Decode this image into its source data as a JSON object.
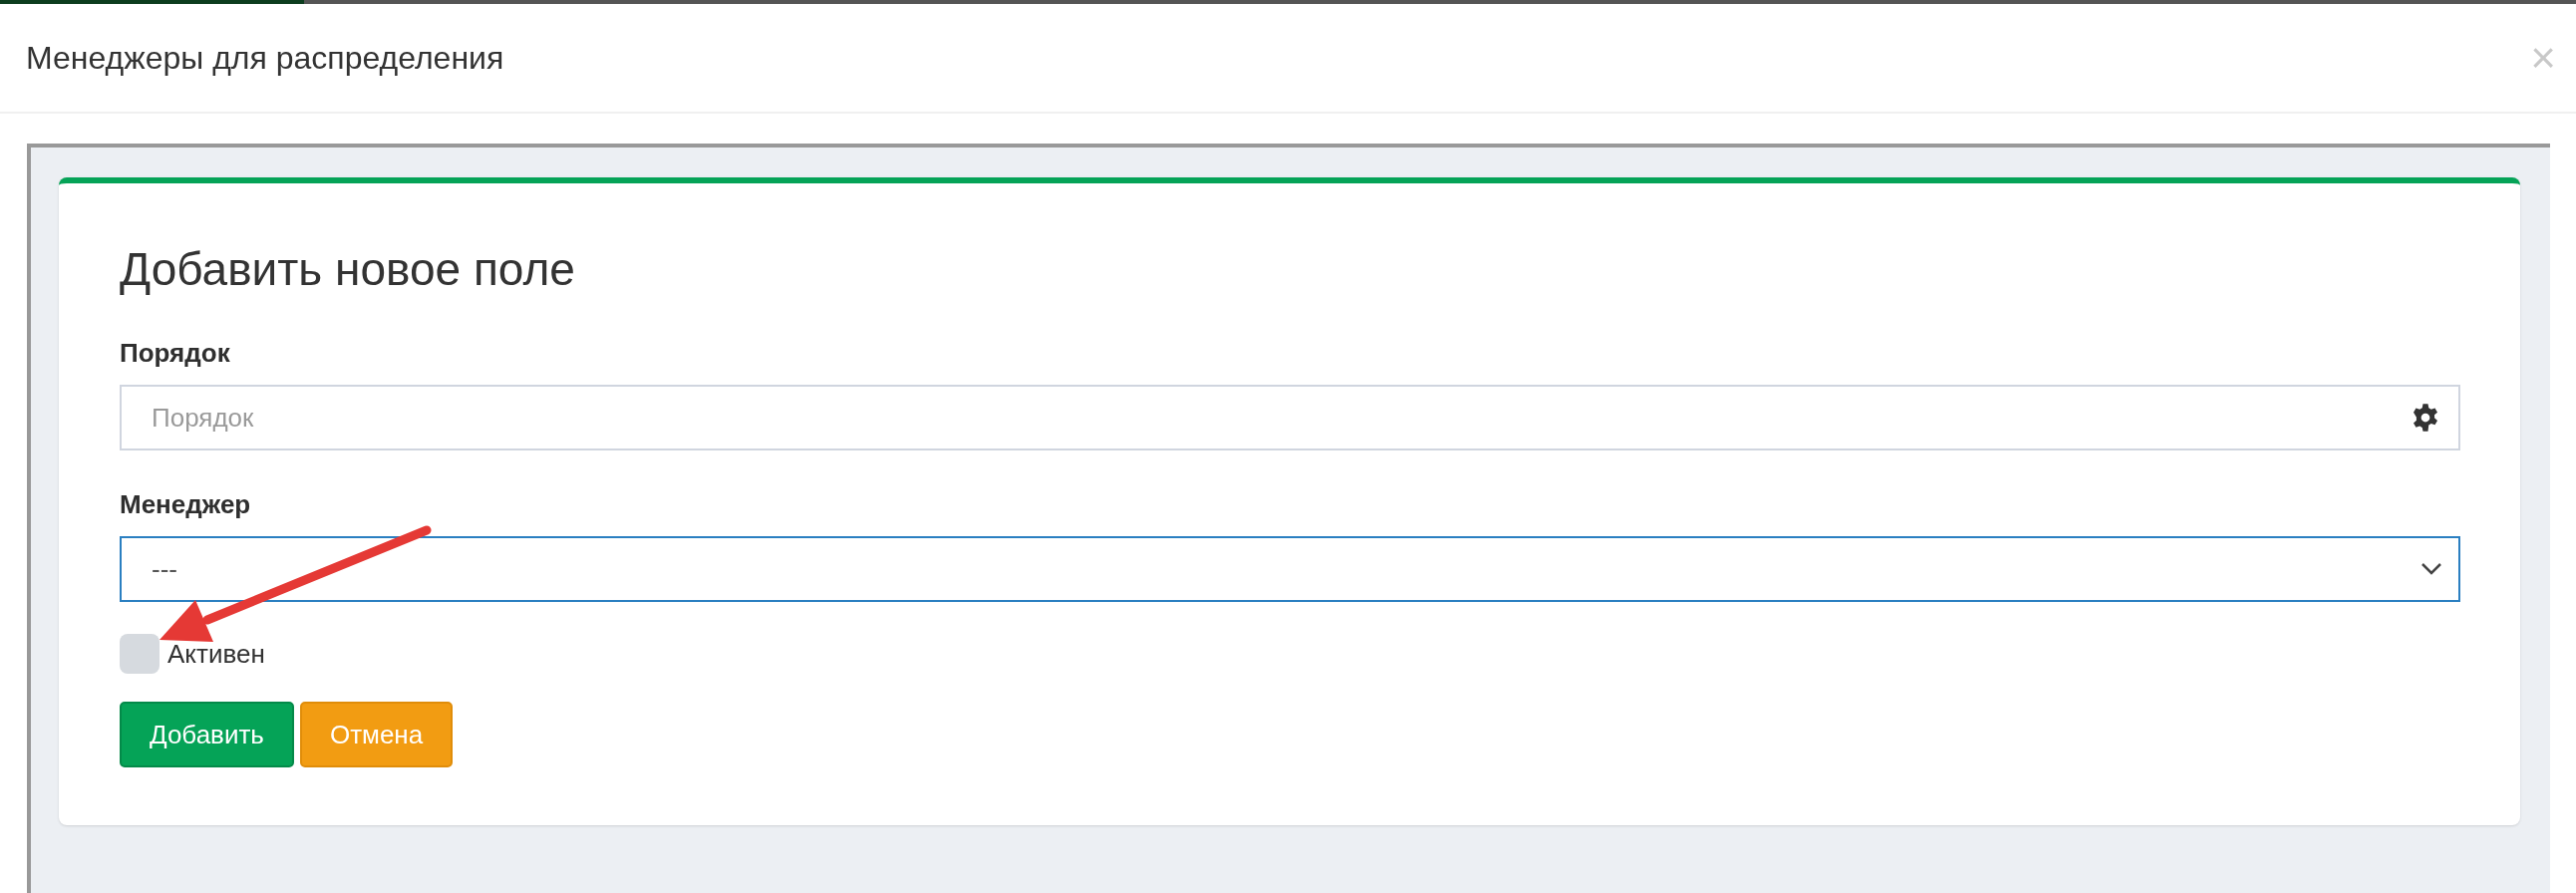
{
  "loading_bar": {
    "level": 0.118
  },
  "dialog": {
    "title": "Менеджеры для распределения",
    "close": "×"
  },
  "form": {
    "heading": "Добавить новое поле",
    "fields": [
      {
        "kind": "input",
        "label": "Порядок",
        "placeholder": "Порядок"
      },
      {
        "kind": "select",
        "label": "Менеджер",
        "value": "---",
        "focused": true
      }
    ],
    "checkbox": {
      "label": "Активен",
      "checked": false
    },
    "buttons": [
      {
        "kind": "primary",
        "label": "Добавить"
      },
      {
        "kind": "warning",
        "label": "Отмена"
      }
    ]
  }
}
